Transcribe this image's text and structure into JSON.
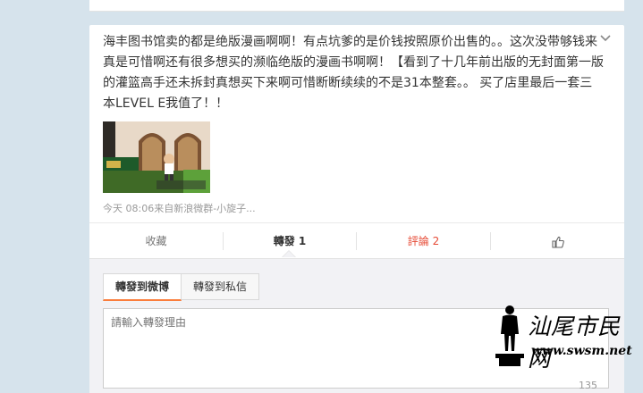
{
  "post": {
    "text": "海丰图书馆卖的都是绝版漫画啊啊！有点坑爹的是价钱按照原价出售的。。这次没带够钱来真是可惜啊还有很多想买的濒临绝版的漫画书啊啊！【看到了十几年前出版的无封面第一版的灌篮高手还未拆封真想买下来啊可惜断断续续的不是31本整套。。 买了店里最后一套三本LEVEL E我值了！！",
    "meta": "今天 08:06来自新浪微群-小旋子...",
    "image_caption": "微博图片"
  },
  "actions": {
    "favorite": "收藏",
    "repost": "轉發 1",
    "comment": "評論 2"
  },
  "repost_panel": {
    "tabs": [
      "轉發到微博",
      "轉發到私信"
    ],
    "placeholder": "請輸入轉發理由",
    "counter": "135"
  },
  "watermark": {
    "text_cn": "汕尾市民网",
    "url": "www.swsm.net"
  },
  "colors": {
    "background": "#d6e3ec",
    "comment_accent": "#e64a35",
    "tab_accent": "#fa7d3c"
  }
}
